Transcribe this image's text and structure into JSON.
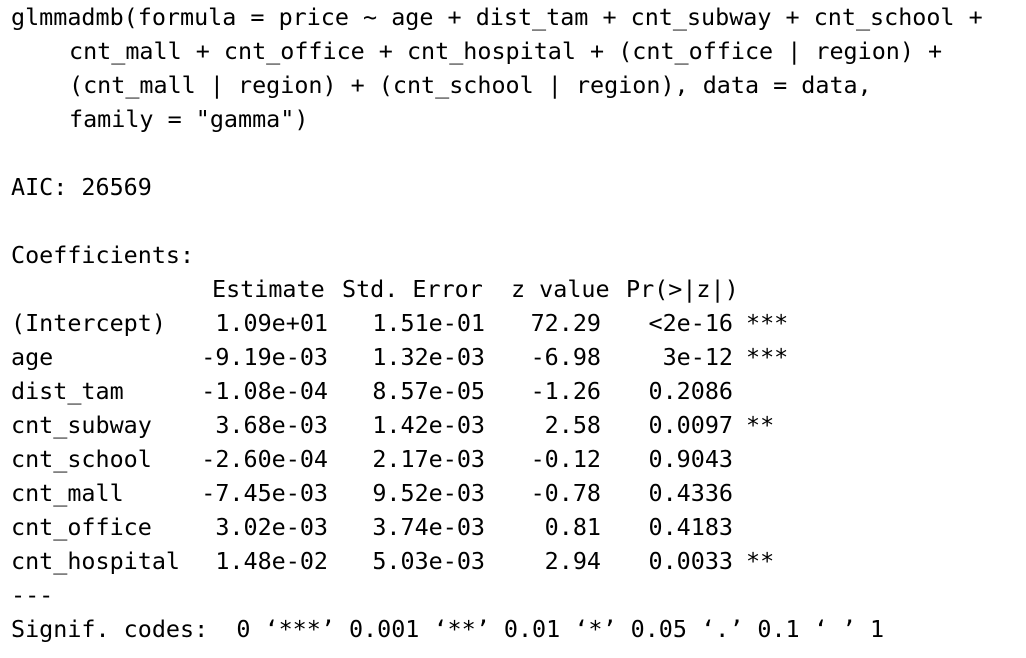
{
  "call": {
    "lines": [
      "glmmadmb(formula = price ~ age + dist_tam + cnt_subway + cnt_school +",
      "cnt_mall + cnt_office + cnt_hospital + (cnt_office | region) +",
      "(cnt_mall | region) + (cnt_school | region), data = data,",
      "family = \"gamma\")"
    ]
  },
  "aic": "AIC: 26569",
  "coefficients": {
    "title": "Coefficients:",
    "headers": [
      "Estimate",
      "Std. Error",
      "z value",
      "Pr(>|z|)"
    ],
    "rows": [
      {
        "name": "(Intercept)",
        "estimate": "1.09e+01",
        "std_error": "1.51e-01",
        "z_value": "72.29",
        "p_value": "<2e-16",
        "signif": "***"
      },
      {
        "name": "age",
        "estimate": "-9.19e-03",
        "std_error": "1.32e-03",
        "z_value": "-6.98",
        "p_value": "3e-12",
        "signif": "***"
      },
      {
        "name": "dist_tam",
        "estimate": "-1.08e-04",
        "std_error": "8.57e-05",
        "z_value": "-1.26",
        "p_value": "0.2086",
        "signif": ""
      },
      {
        "name": "cnt_subway",
        "estimate": "3.68e-03",
        "std_error": "1.42e-03",
        "z_value": "2.58",
        "p_value": "0.0097",
        "signif": "**"
      },
      {
        "name": "cnt_school",
        "estimate": "-2.60e-04",
        "std_error": "2.17e-03",
        "z_value": "-0.12",
        "p_value": "0.9043",
        "signif": ""
      },
      {
        "name": "cnt_mall",
        "estimate": "-7.45e-03",
        "std_error": "9.52e-03",
        "z_value": "-0.78",
        "p_value": "0.4336",
        "signif": ""
      },
      {
        "name": "cnt_office",
        "estimate": "3.02e-03",
        "std_error": "3.74e-03",
        "z_value": "0.81",
        "p_value": "0.4183",
        "signif": ""
      },
      {
        "name": "cnt_hospital",
        "estimate": "1.48e-02",
        "std_error": "5.03e-03",
        "z_value": "2.94",
        "p_value": "0.0033",
        "signif": "**"
      }
    ]
  },
  "separator": "---",
  "signif_codes": "Signif. codes:  0 ‘***’ 0.001 ‘**’ 0.01 ‘*’ 0.05 ‘.’ 0.1 ‘ ’ 1"
}
